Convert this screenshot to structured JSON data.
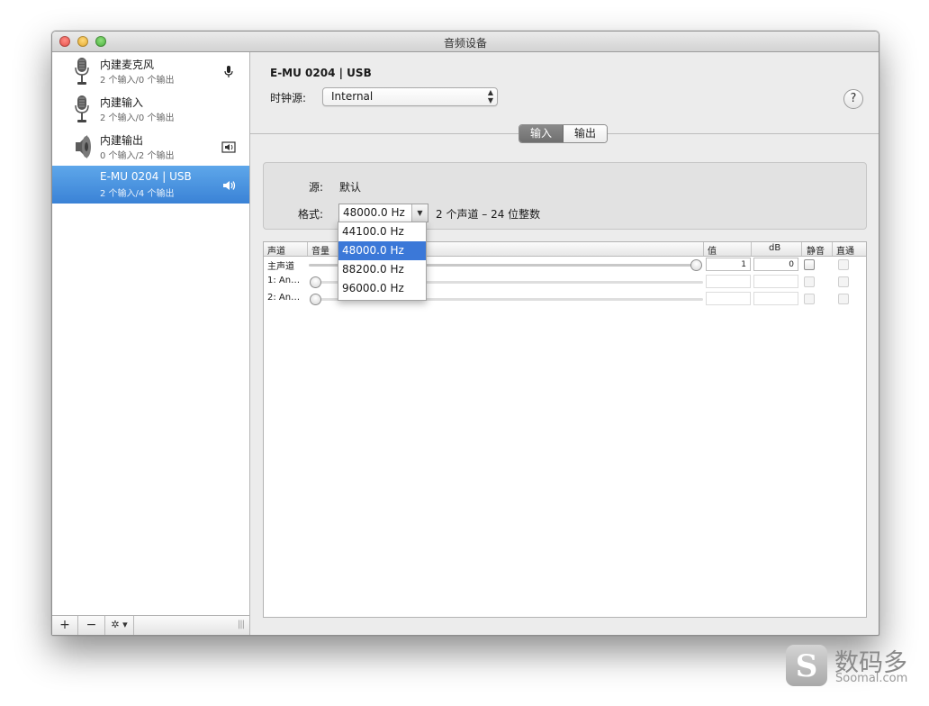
{
  "window": {
    "title": "音频设备"
  },
  "sidebar": {
    "devices": [
      {
        "name": "内建麦克风",
        "sub": "2 个输入/0 个输出",
        "icon": "microphone-icon",
        "status_icon": "mic-status-icon"
      },
      {
        "name": "内建输入",
        "sub": "2 个输入/0 个输出",
        "icon": "microphone-icon"
      },
      {
        "name": "内建输出",
        "sub": "0 个输入/2 个输出",
        "icon": "speaker-icon",
        "status_icon": "system-output-icon"
      },
      {
        "name": "E-MU 0204 | USB",
        "sub": "2 个输入/4 个输出",
        "selected": true,
        "status_icon": "speaker-volume-icon"
      }
    ],
    "footer": {
      "add": "+",
      "remove": "−",
      "gear": "✲ ▾",
      "grip": "|||"
    }
  },
  "main": {
    "device_title": "E-MU 0204 | USB",
    "clock_label": "时钟源:",
    "clock_value": "Internal",
    "help": "?",
    "tabs": [
      {
        "label": "输入",
        "active": true
      },
      {
        "label": "输出",
        "active": false
      }
    ],
    "source_label": "源:",
    "source_value": "默认",
    "format_label": "格式:",
    "format_value": "48000.0 Hz",
    "format_desc": "2 个声道 – 24 位整数"
  },
  "table": {
    "columns": [
      "声道",
      "音量",
      "值",
      "dB",
      "静音",
      "直通"
    ],
    "rows": [
      {
        "channel": "主声道",
        "value": "1",
        "db": "0",
        "volume": 1.0,
        "enabled": true
      },
      {
        "channel": "1: An…",
        "value": "",
        "db": "",
        "volume": 0.0,
        "enabled": false
      },
      {
        "channel": "2: An…",
        "value": "",
        "db": "",
        "volume": 0.0,
        "enabled": false
      }
    ]
  },
  "format_menu": {
    "options": [
      "44100.0 Hz",
      "48000.0 Hz",
      "88200.0 Hz",
      "96000.0 Hz"
    ],
    "selected": "48000.0 Hz"
  },
  "watermark": {
    "cn": "数码多",
    "en": "Soomal.com",
    "logo": "S"
  },
  "colors": {
    "selection": "#3b78d8",
    "sidebar_selection": "#4a91e0"
  }
}
